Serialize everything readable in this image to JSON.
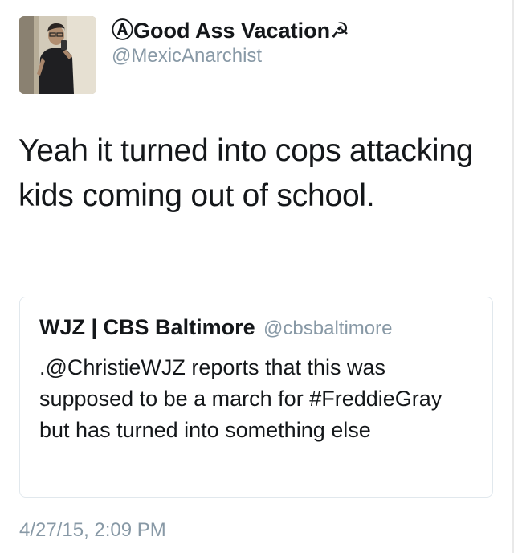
{
  "author": {
    "display_name": "ⒶGood Ass Vacation☭",
    "handle": "@MexicAnarchist"
  },
  "tweet": {
    "text": "Yeah it turned into cops attacking kids coming out of school.",
    "timestamp": "4/27/15, 2:09 PM"
  },
  "quoted_tweet": {
    "display_name": "WJZ | CBS Baltimore",
    "handle": "@cbsbaltimore",
    "text": ".@ChristieWJZ reports that this was supposed to be a march for #FreddieGray but has turned into something else"
  },
  "colors": {
    "text_primary": "#14171a",
    "text_secondary": "#8899a6",
    "card_border": "#e1e8ed"
  }
}
